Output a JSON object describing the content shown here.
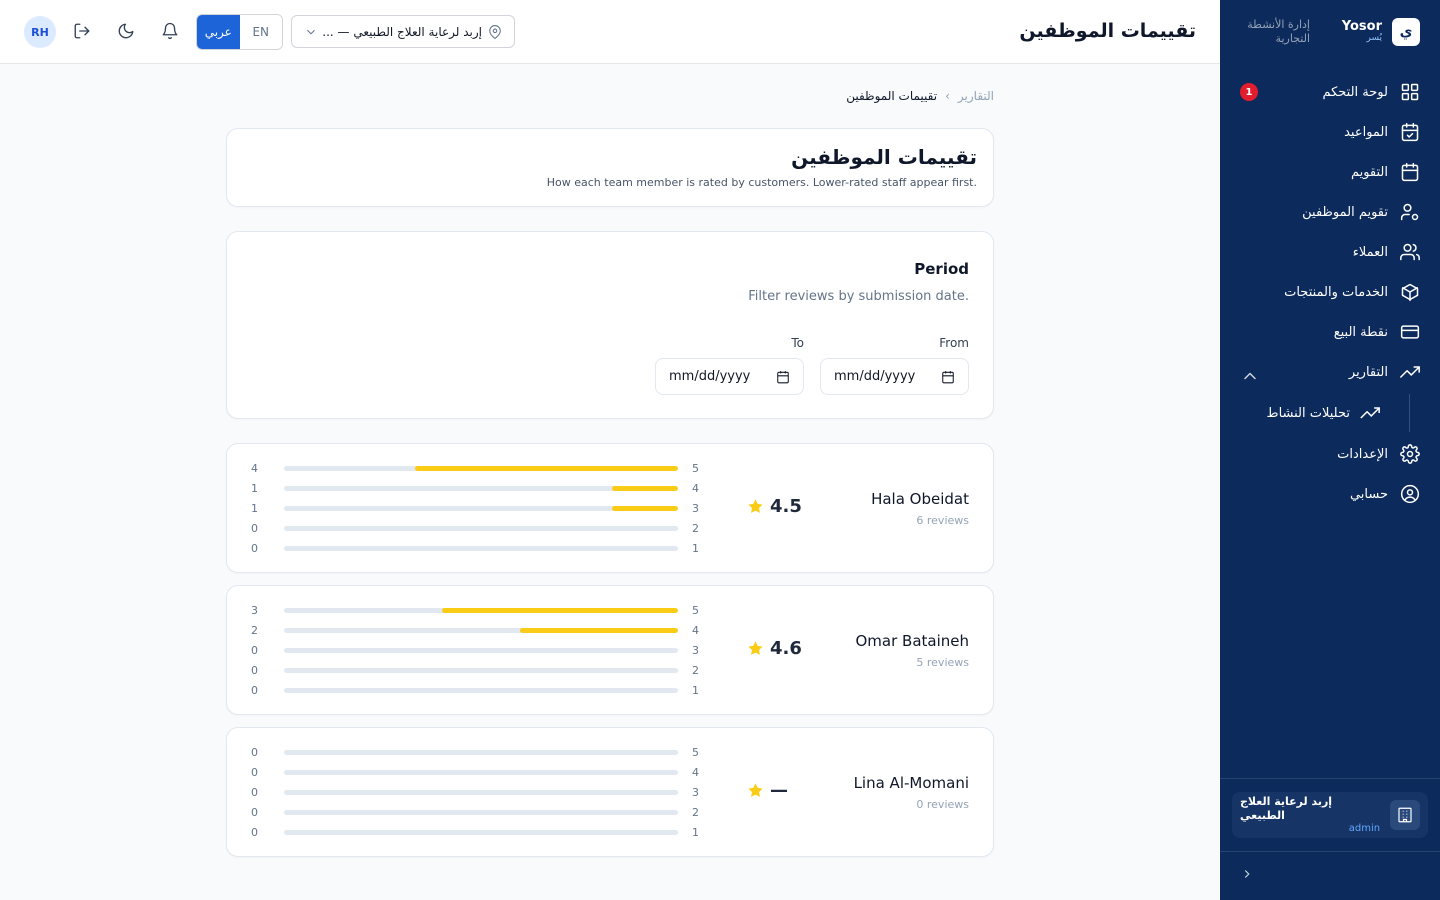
{
  "topbar": {
    "title": "تقييمات الموظفين",
    "avatar": "RH",
    "lang_ar": "عربي",
    "lang_en": "EN",
    "location": "إربد لرعاية العلاج الطبيعي — ..."
  },
  "sidebar": {
    "brand_name": "Yosor",
    "brand_sub": "يُسر",
    "brand_tag": "إدارة الأنشطة التجارية",
    "items": [
      {
        "label": "لوحة التحكم",
        "icon": "grid-icon",
        "badge": "1"
      },
      {
        "label": "المواعيد",
        "icon": "calendar-check-icon"
      },
      {
        "label": "التقويم",
        "icon": "calendar-icon"
      },
      {
        "label": "تقويم الموظفين",
        "icon": "user-cog-icon"
      },
      {
        "label": "العملاء",
        "icon": "users-icon"
      },
      {
        "label": "الخدمات والمنتجات",
        "icon": "box-icon"
      },
      {
        "label": "نقطة البيع",
        "icon": "credit-card-icon"
      },
      {
        "label": "التقارير",
        "icon": "trending-up-icon"
      }
    ],
    "sub_items": [
      {
        "label": "تحليلات النشاط",
        "icon": "trending-up-icon"
      }
    ],
    "bottom_items": [
      {
        "label": "الإعدادات",
        "icon": "gear-icon"
      },
      {
        "label": "حسابي",
        "icon": "user-circle-icon"
      }
    ],
    "org_name": "إربد لرعاية العلاج الطبيعي",
    "org_role": "admin"
  },
  "breadcrumb": {
    "root": "التقارير",
    "current": "تقييمات الموظفين"
  },
  "header_card": {
    "title": "تقييمات الموظفين",
    "subtitle": "How each team member is rated by customers. Lower-rated staff appear first."
  },
  "period": {
    "title": "Period",
    "subtitle": "Filter reviews by submission date.",
    "from_label": "From",
    "to_label": "To",
    "from_placeholder": "mm/dd/yyyy",
    "to_placeholder": "mm/dd/yyyy"
  },
  "colors": {
    "sidebar_bg": "#0c2a5b",
    "accent": "#1d64d8",
    "star": "#facc15",
    "badge": "#e11d2e"
  },
  "staff": [
    {
      "name": "Hala Obeidat",
      "reviews": "6 reviews",
      "rating": "4.5",
      "distribution": [
        {
          "star": "5",
          "count": "4",
          "fraction": 0.667
        },
        {
          "star": "4",
          "count": "1",
          "fraction": 0.167
        },
        {
          "star": "3",
          "count": "1",
          "fraction": 0.167
        },
        {
          "star": "2",
          "count": "0",
          "fraction": 0
        },
        {
          "star": "1",
          "count": "0",
          "fraction": 0
        }
      ]
    },
    {
      "name": "Omar Bataineh",
      "reviews": "5 reviews",
      "rating": "4.6",
      "distribution": [
        {
          "star": "5",
          "count": "3",
          "fraction": 0.6
        },
        {
          "star": "4",
          "count": "2",
          "fraction": 0.4
        },
        {
          "star": "3",
          "count": "0",
          "fraction": 0
        },
        {
          "star": "2",
          "count": "0",
          "fraction": 0
        },
        {
          "star": "1",
          "count": "0",
          "fraction": 0
        }
      ]
    },
    {
      "name": "Lina Al-Momani",
      "reviews": "0 reviews",
      "rating": "—",
      "distribution": [
        {
          "star": "5",
          "count": "0",
          "fraction": 0
        },
        {
          "star": "4",
          "count": "0",
          "fraction": 0
        },
        {
          "star": "3",
          "count": "0",
          "fraction": 0
        },
        {
          "star": "2",
          "count": "0",
          "fraction": 0
        },
        {
          "star": "1",
          "count": "0",
          "fraction": 0
        }
      ]
    }
  ]
}
